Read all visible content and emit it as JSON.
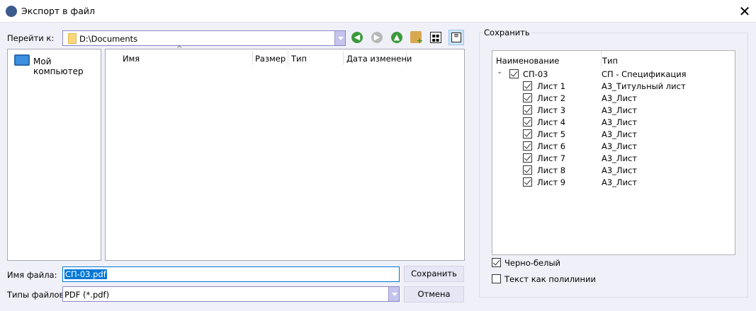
{
  "window": {
    "title": "Экспорт в файл",
    "close_icon": "close-icon"
  },
  "nav": {
    "goto_label": "Перейти к:",
    "path": "D:\\Documents",
    "icons": [
      "back-icon",
      "forward-icon",
      "up-icon",
      "new-folder-icon",
      "icons-view-icon",
      "details-view-icon"
    ]
  },
  "places": [
    {
      "label": "Мой компьютер",
      "icon": "computer-icon"
    }
  ],
  "file_list": {
    "columns": [
      "Имя",
      "Размер",
      "Тип",
      "Дата изменени"
    ],
    "rows": []
  },
  "filename": {
    "label": "Имя файла:",
    "value": "СП-03.pdf"
  },
  "filetype": {
    "label": "Типы файлов:",
    "value": "PDF (*.pdf)"
  },
  "buttons": {
    "save": "Сохранить",
    "cancel": "Отмена"
  },
  "save_group": {
    "title": "Сохранить",
    "columns": [
      "Наименование",
      "Тип"
    ],
    "root": {
      "name": "СП-03",
      "type": "СП - Спецификация",
      "checked": true,
      "expanded": true
    },
    "sheets": [
      {
        "name": "Лист 1",
        "type": "А3_Титульный лист",
        "checked": true
      },
      {
        "name": "Лист 2",
        "type": "А3_Лист",
        "checked": true
      },
      {
        "name": "Лист 3",
        "type": "А3_Лист",
        "checked": true
      },
      {
        "name": "Лист 4",
        "type": "А3_Лист",
        "checked": true
      },
      {
        "name": "Лист 5",
        "type": "А3_Лист",
        "checked": true
      },
      {
        "name": "Лист 6",
        "type": "А3_Лист",
        "checked": true
      },
      {
        "name": "Лист 7",
        "type": "А3_Лист",
        "checked": true
      },
      {
        "name": "Лист 8",
        "type": "А3_Лист",
        "checked": true
      },
      {
        "name": "Лист 9",
        "type": "А3_Лист",
        "checked": true
      }
    ],
    "options": [
      {
        "label": "Черно-белый",
        "checked": true
      },
      {
        "label": "Текст как полилинии",
        "checked": false
      }
    ]
  },
  "colors": {
    "accent": "#0078d7",
    "background": "#f0f0f8"
  }
}
